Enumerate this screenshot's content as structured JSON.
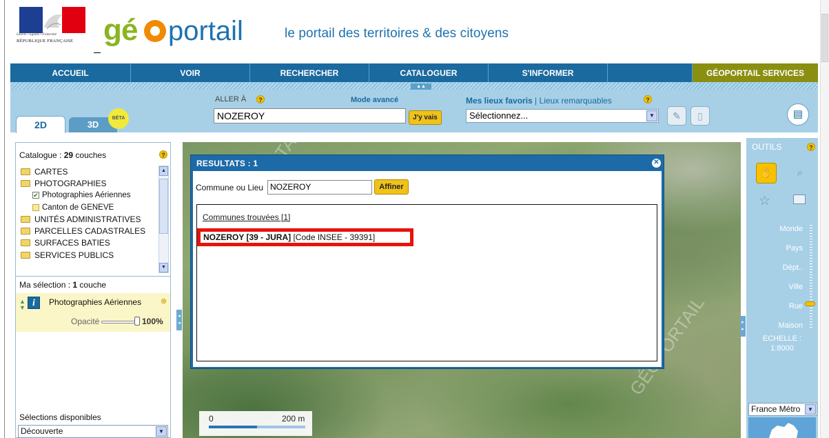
{
  "header": {
    "rf_motto": "Liberté • Égalité • Fraternité",
    "rf_name": "RÉPUBLIQUE FRANÇAISE",
    "logo_text": "géoportail",
    "tagline": "le portail des territoires & des citoyens"
  },
  "nav": {
    "items": [
      "ACCUEIL",
      "VOIR",
      "RECHERCHER",
      "CATALOGUER",
      "S'INFORMER",
      "",
      "GÉOPORTAIL SERVICES"
    ]
  },
  "toolbar": {
    "tab_2d": "2D",
    "tab_3d": "3D",
    "beta": "BÉTA",
    "goto_label": "ALLER À",
    "mode_avance": "Mode avancé",
    "goto_value": "NOZEROY",
    "goto_button": "J'y vais",
    "favoris_label": "Mes lieux favoris",
    "favoris_sep": " | ",
    "remarquables_label": "Lieux remarquables",
    "favoris_select": "Sélectionnez..."
  },
  "catalog": {
    "title_prefix": "Catalogue : ",
    "count": "29",
    "title_suffix": " couches",
    "items": [
      {
        "label": "CARTES",
        "kind": "folder"
      },
      {
        "label": "PHOTOGRAPHIES",
        "kind": "folder"
      },
      {
        "label": "Photographies Aériennes",
        "kind": "checked"
      },
      {
        "label": "Canton de GENEVE",
        "kind": "box"
      },
      {
        "label": "UNITÉS ADMINISTRATIVES",
        "kind": "folder"
      },
      {
        "label": "PARCELLES CADASTRALES",
        "kind": "folder"
      },
      {
        "label": "SURFACES BATIES",
        "kind": "folder"
      },
      {
        "label": "SERVICES PUBLICS",
        "kind": "folder"
      }
    ],
    "selection_prefix": "Ma sélection : ",
    "selection_count": "1",
    "selection_suffix": " couche",
    "selected_layer": "Photographies Aériennes",
    "opacity_label": "Opacité",
    "opacity_value": "100%",
    "opacity_level": 1.0,
    "available_title": "Sélections disponibles",
    "available_value": "Découverte"
  },
  "map": {
    "scale_zero": "0",
    "scale_distance": "200 m"
  },
  "dialog": {
    "title": "RESULTATS : 1",
    "field_label": "Commune ou Lieu",
    "field_value": "NOZEROY",
    "affiner": "Affiner",
    "results_heading": "Communes trouvées [1]",
    "result_name": "NOZEROY [39 - JURA]",
    "result_code": " [Code INSEE - 39391]"
  },
  "tools": {
    "title": "OUTILS",
    "zoom_levels": [
      "Monde",
      "Pays",
      "Dépt..",
      "Ville",
      "Rue",
      "Maison"
    ],
    "current_level": "Rue",
    "echelle_label": "ECHELLE :",
    "echelle_value": "1:8000",
    "territory_select": "France Métro"
  },
  "colors": {
    "nav_blue": "#1a6a9f",
    "services_olive": "#8a8f11",
    "dialog_blue": "#1d6aa8",
    "highlight_red": "#e8120c",
    "button_yellow": "#f0c21a",
    "panel_light_blue": "#a7d0e7"
  }
}
